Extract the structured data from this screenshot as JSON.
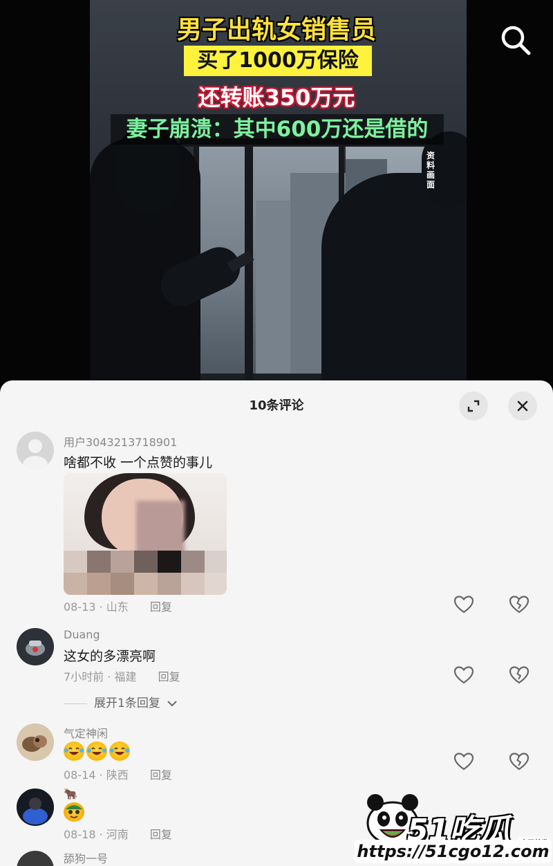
{
  "video": {
    "title_line1": "男子出轨女销售员",
    "title_line2": "买了1000万保险",
    "title_line3": "还转账350万元",
    "title_line4": "妻子崩溃：其中600万还是借的",
    "source_tag": "资料画面",
    "search_icon": "search-icon"
  },
  "sheet": {
    "title": "10条评论",
    "expand_icon": "expand-icon",
    "close_icon": "close-icon"
  },
  "comments": [
    {
      "username": "用户3043213718901",
      "text": "啥都不收 一个点赞的事儿",
      "date": "08-13",
      "location": "山东",
      "reply": "回复",
      "has_image": true
    },
    {
      "username": "Duang",
      "text": "这女的多漂亮啊",
      "date": "7小时前",
      "location": "福建",
      "reply": "回复",
      "expand_replies": "展开1条回复"
    },
    {
      "username": "气定神闲",
      "text": "",
      "date": "08-14",
      "location": "陕西",
      "reply": "回复"
    },
    {
      "username": "🐂",
      "text": "",
      "date": "08-18",
      "location": "河南",
      "reply": "回复"
    },
    {
      "username": "舔狗一号"
    }
  ],
  "watermark": {
    "logo": "51吃瓜",
    "small": "全网首发",
    "url": "https://51cgo12.com"
  },
  "colors": {
    "title_yellow": "#ffe23a",
    "title_green": "#7df29e",
    "title_red_outline": "#c8102e",
    "sheet_bg": "#f5f5f5"
  }
}
